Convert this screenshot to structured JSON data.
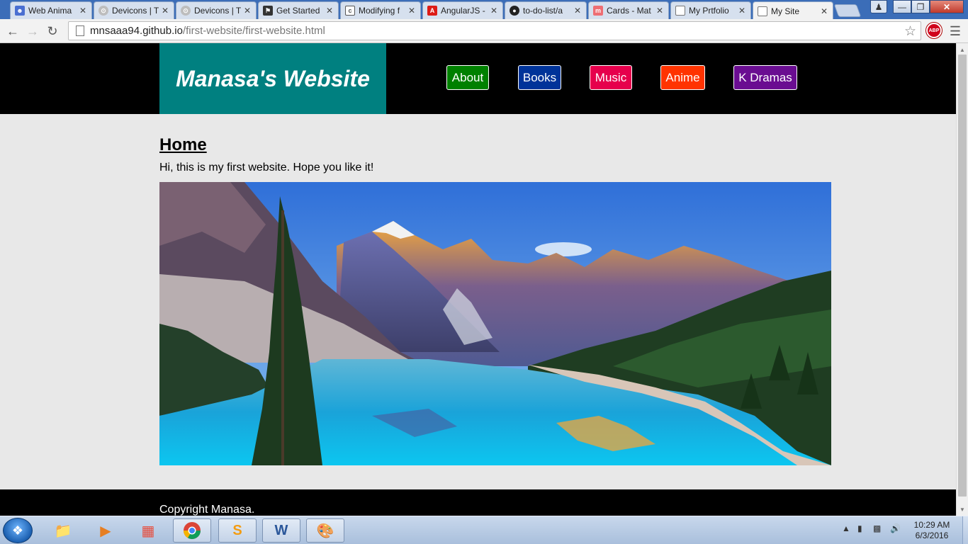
{
  "browser": {
    "tabs": [
      {
        "title": "Web Anima",
        "icon": "contact-icon",
        "color": "#4a6fd1"
      },
      {
        "title": "Devicons | T",
        "icon": "devicons-icon",
        "color": "#9e9e9e"
      },
      {
        "title": "Devicons | T",
        "icon": "devicons-icon",
        "color": "#9e9e9e"
      },
      {
        "title": "Get Started",
        "icon": "flag-icon",
        "color": "#333333"
      },
      {
        "title": "Modifying f",
        "icon": "codepen-icon",
        "color": "#555555"
      },
      {
        "title": "AngularJS - ",
        "icon": "angular-icon",
        "color": "#dd1b16"
      },
      {
        "title": "to-do-list/a",
        "icon": "github-icon",
        "color": "#222222"
      },
      {
        "title": "Cards - Mat",
        "icon": "materialize-icon",
        "color": "#ee6e73"
      },
      {
        "title": "My Prtfolio",
        "icon": "page-icon",
        "color": "#777777"
      },
      {
        "title": "My Site",
        "icon": "page-icon",
        "color": "#777777"
      }
    ],
    "url_host": "mnsaaa94.github.io",
    "url_path": "/first-website/first-website.html",
    "adblock_label": "ABP"
  },
  "site": {
    "logo": "Manasa's Website",
    "nav": [
      {
        "label": "About",
        "color": "#008000"
      },
      {
        "label": "Books",
        "color": "#003399"
      },
      {
        "label": "Music",
        "color": "#e6004c"
      },
      {
        "label": "Anime",
        "color": "#ff3300"
      },
      {
        "label": "K Dramas",
        "color": "#6a0d91"
      }
    ],
    "heading": "Home",
    "intro": "Hi, this is my first website. Hope you like it!",
    "footer": "Copyright Manasa."
  },
  "taskbar": {
    "time": "10:29 AM",
    "date": "6/3/2016"
  },
  "colors": {
    "header_bg": "#000000",
    "logo_bg": "#008080",
    "page_bg": "#e8e8e8"
  }
}
